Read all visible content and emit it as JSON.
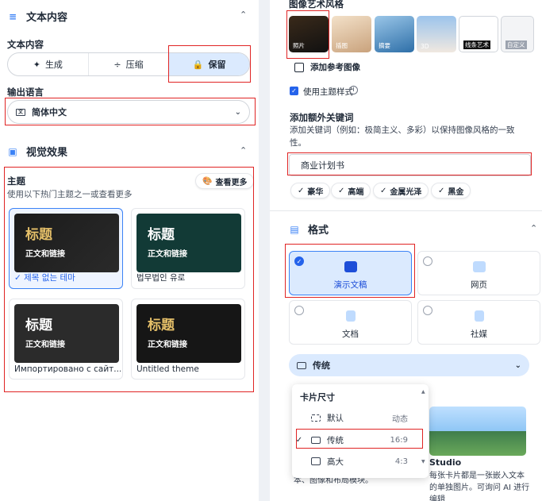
{
  "left": {
    "text_section": {
      "title": "文本内容",
      "mode_label": "文本内容",
      "modes": [
        {
          "icon": "✦",
          "label": "生成"
        },
        {
          "icon": "÷",
          "label": "压缩"
        },
        {
          "icon": "🔒",
          "label": "保留"
        }
      ]
    },
    "language": {
      "label": "输出语言",
      "value": "简体中文"
    },
    "visual": {
      "title": "视觉效果",
      "theme_label": "主题",
      "theme_desc": "使用以下热门主题之一或查看更多",
      "view_more": "查看更多",
      "themes": [
        {
          "title": "标题",
          "body": "正文和链接",
          "caption": "✓ 제목 없는 테마"
        },
        {
          "title": "标题",
          "body": "正文和链接",
          "caption": "법무법인 유로"
        },
        {
          "title": "标题",
          "body": "正文和链接",
          "caption": "Импортировано с сайт..."
        },
        {
          "title": "标题",
          "body": "正文和链接",
          "caption": "Untitled theme"
        }
      ]
    }
  },
  "right": {
    "art_style_label": "图像艺术风格",
    "styles": [
      {
        "label": "照片"
      },
      {
        "label": "插图"
      },
      {
        "label": "摘要"
      },
      {
        "label": "3D"
      },
      {
        "label": "线条艺术"
      },
      {
        "label": "自定义"
      }
    ],
    "add_reference": "添加参考图像",
    "use_theme_style": "使用主题样式",
    "keywords_label": "添加额外关键词",
    "keywords_desc": "添加关键词（例如：极简主义、多彩）以保持图像风格的一致性。",
    "keyword_input": "商业计划书",
    "keyword_pills": [
      "豪华",
      "高端",
      "金属光泽",
      "黑金"
    ],
    "format": {
      "title": "格式",
      "options": [
        "演示文稿",
        "网页",
        "文档",
        "社媒"
      ]
    },
    "card_style": "传统",
    "card_size_menu": {
      "title": "卡片尺寸",
      "rows": [
        {
          "label": "默认",
          "right": "动态",
          "checked": ""
        },
        {
          "label": "传统",
          "right": "16:9",
          "checked": "✓"
        },
        {
          "label": "高大",
          "right": "4:3",
          "checked": ""
        }
      ]
    },
    "preview": {
      "title": "Studio",
      "desc": "每张卡片都是一张嵌入文本的单独图片。可询问 AI 进行编辑"
    },
    "hidden_text": "本、图像和布局模块。"
  }
}
